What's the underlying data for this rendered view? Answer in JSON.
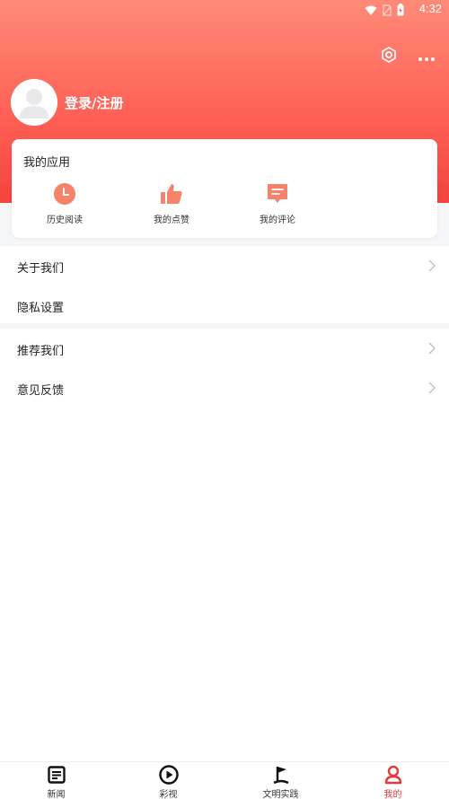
{
  "status_bar": {
    "time": "4:32"
  },
  "profile": {
    "login_label": "登录/注册"
  },
  "apps": {
    "title": "我的应用",
    "items": [
      {
        "label": "历史阅读",
        "icon": "clock-icon"
      },
      {
        "label": "我的点赞",
        "icon": "thumbs-up-icon"
      },
      {
        "label": "我的评论",
        "icon": "comment-icon"
      }
    ]
  },
  "menu": {
    "group1": [
      {
        "label": "关于我们",
        "has_arrow": true
      },
      {
        "label": "隐私设置",
        "has_arrow": false
      }
    ],
    "group2": [
      {
        "label": "推荐我们",
        "has_arrow": true
      },
      {
        "label": "意见反馈",
        "has_arrow": true
      }
    ]
  },
  "tabs": [
    {
      "label": "新闻",
      "icon": "news-icon",
      "active": false
    },
    {
      "label": "彩视",
      "icon": "play-icon",
      "active": false
    },
    {
      "label": "文明实践",
      "icon": "flag-icon",
      "active": false
    },
    {
      "label": "我的",
      "icon": "user-icon",
      "active": true
    }
  ],
  "colors": {
    "accent": "#e4393c",
    "icon_orange": "#f6826a",
    "header_top": "#ff8a78",
    "header_bottom": "#f4433c"
  }
}
